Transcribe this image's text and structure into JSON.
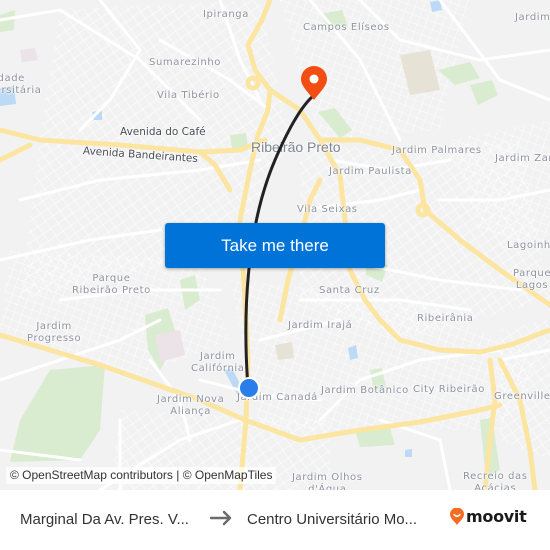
{
  "map": {
    "city": "Ribeirão Preto",
    "neighborhoods": [
      {
        "id": "ipiranga",
        "label": "Ipiranga"
      },
      {
        "id": "campos-eliseos",
        "label": "Campos Elíseos"
      },
      {
        "id": "jardim-ne",
        "label": "Jardim"
      },
      {
        "id": "sumarezinho",
        "label": "Sumarezinho"
      },
      {
        "id": "cidade-universitaria",
        "label": "Cidade\nUniversitária"
      },
      {
        "id": "vila-tiberio",
        "label": "Vila Tibério"
      },
      {
        "id": "jardim-palmares",
        "label": "Jardim Palmares"
      },
      {
        "id": "jardim-zara",
        "label": "Jardim Zara"
      },
      {
        "id": "jardim-paulista",
        "label": "Jardim Paulista"
      },
      {
        "id": "vila-seixas",
        "label": "Vila Seixas"
      },
      {
        "id": "lagoinha",
        "label": "Lagoinha"
      },
      {
        "id": "parque-ribeirao-preto",
        "label": "Parque\nRibeirão Preto"
      },
      {
        "id": "parque-lagos",
        "label": "Parque\nLagos"
      },
      {
        "id": "santa-cruz",
        "label": "Santa Cruz"
      },
      {
        "id": "jardim-progresso",
        "label": "Jardim\nProgresso"
      },
      {
        "id": "jardim-iraja",
        "label": "Jardim Irajá"
      },
      {
        "id": "ribeirania",
        "label": "Ribeirânia"
      },
      {
        "id": "jardim-california",
        "label": "Jardim\nCalifórnia"
      },
      {
        "id": "jardim-nova-alianca",
        "label": "Jardim Nova\nAliança"
      },
      {
        "id": "jardim-canada",
        "label": "Jardim Canadá"
      },
      {
        "id": "jardim-botanico",
        "label": "Jardim Botânico"
      },
      {
        "id": "city-ribeirao",
        "label": "City Ribeirão"
      },
      {
        "id": "greenville",
        "label": "Greenville"
      },
      {
        "id": "jardim-olhos-dagua",
        "label": "Jardim Olhos\nd'Água"
      },
      {
        "id": "recreio-das-acacias",
        "label": "Recreio das\nAcácias"
      }
    ],
    "roads": [
      {
        "id": "avenida-do-cafe",
        "label": "Avenida do Café"
      },
      {
        "id": "avenida-bandeirantes",
        "label": "Avenida Bandeirantes"
      }
    ],
    "colors": {
      "background": "#f2f2f2",
      "major_road": "#fbe5a0",
      "minor_road": "#ffffff",
      "park": "#d9ecd0",
      "water": "#bcdaf5",
      "route_line": "#222222",
      "origin_marker": "#2b7de9",
      "destination_marker": "#f24d12"
    }
  },
  "cta": {
    "label": "Take me there",
    "color": "#0073d8"
  },
  "attribution": "© OpenStreetMap contributors | © OpenMapTiles",
  "footer": {
    "origin": "Marginal Da Av. Pres. V...",
    "arrow_icon": "arrow-right",
    "destination": "Centro Universitário Mo...",
    "brand": "moovit",
    "brand_color": "#f26d21"
  }
}
